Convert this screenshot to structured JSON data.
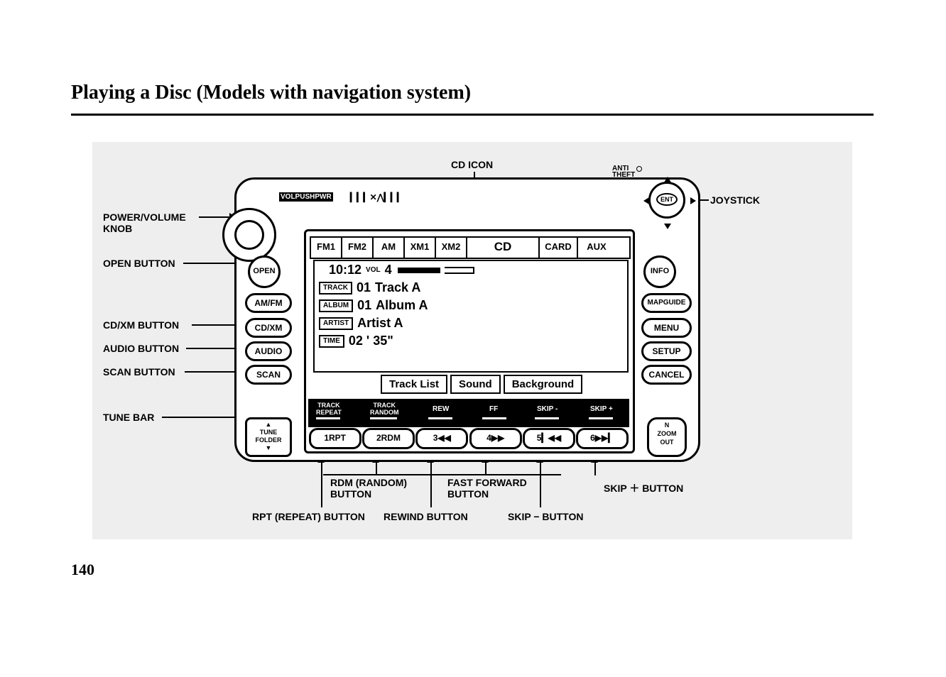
{
  "page": {
    "title": "Playing a Disc (Models with navigation system)",
    "number": "140"
  },
  "callouts": {
    "cd_icon": "CD ICON",
    "power_volume_knob": "POWER/VOLUME\nKNOB",
    "open_button": "OPEN BUTTON",
    "cd_xm_button": "CD/XM BUTTON",
    "audio_button": "AUDIO BUTTON",
    "scan_button": "SCAN BUTTON",
    "tune_bar": "TUNE BAR",
    "joystick": "JOYSTICK",
    "rdm_button": "RDM (RANDOM)\nBUTTON",
    "fast_forward": "FAST FORWARD\nBUTTON",
    "skip_plus": "SKIP ＋ BUTTON",
    "rpt_button": "RPT (REPEAT) BUTTON",
    "rewind_button": "REWIND BUTTON",
    "skip_minus": "SKIP − BUTTON"
  },
  "unit": {
    "top_text": "VOLPUSHPWR",
    "anti_theft": "ANTI\nTHEFT",
    "open": "OPEN",
    "side_left": {
      "amfm": "AM/FM",
      "cdxm": "CD/XM",
      "audio": "AUDIO",
      "scan": "SCAN"
    },
    "side_right": {
      "info": "INFO",
      "mapguide": "MAPGUIDE",
      "menu": "MENU",
      "setup": "SETUP",
      "cancel": "CANCEL",
      "zoom": "N\nZOOM\nOUT"
    },
    "tune": "▲\nTUNE\nFOLDER\n▼",
    "joystick_label": "ENT"
  },
  "tabs": [
    "FM1",
    "FM2",
    "AM",
    "XM1",
    "XM2",
    "CD",
    "CARD",
    "AUX"
  ],
  "display": {
    "clock": "10:12",
    "vol_label": "VOL",
    "vol_value": "4",
    "track_tag": "TRACK",
    "track_num": "01",
    "track_name": "Track  A",
    "album_tag": "ALBUM",
    "album_num": "01",
    "album_name": "Album  A",
    "artist_tag": "ARTIST",
    "artist_name": "Artist  A",
    "time_tag": "TIME",
    "time_value": "02 ' 35\"",
    "bottom": {
      "tracklist": "Track  List",
      "sound": "Sound",
      "background": "Background"
    }
  },
  "skip_labels": {
    "track_repeat": "TRACK\nREPEAT",
    "track_random": "TRACK\nRANDOM",
    "rew": "REW",
    "ff": "FF",
    "skip_minus": "SKIP -",
    "skip_plus": "SKIP +"
  },
  "presets": {
    "p1": "1RPT",
    "p2": "2RDM",
    "p3": "3◀◀",
    "p4": "4▶▶",
    "p5": "5▎◀◀",
    "p6": "6▶▶▎"
  }
}
